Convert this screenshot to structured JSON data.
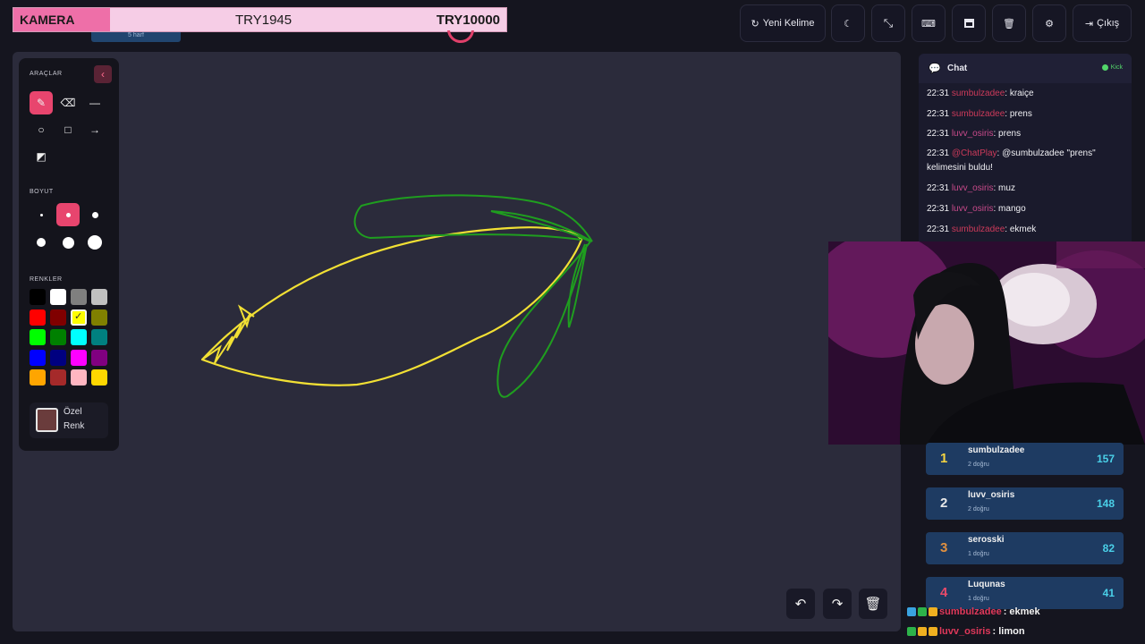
{
  "banner": {
    "left": "KAMERA",
    "mid": "TRY1945",
    "right": "TRY10000"
  },
  "word_hint": "5 harf",
  "toolbar": {
    "new_word": "Yeni Kelime",
    "exit": "Çıkış",
    "icons": [
      "refresh-icon",
      "moon-icon",
      "fullscreen-icon",
      "keyboard-icon",
      "archive-icon",
      "trash-icon",
      "gear-icon",
      "sign-out-icon"
    ]
  },
  "tools": {
    "section_tools": "ARAÇLAR",
    "section_size": "BOYUT",
    "section_colors": "RENKLER",
    "custom_color_line1": "Özel",
    "custom_color_line2": "Renk",
    "colors": [
      "#000000",
      "#ffffff",
      "#7f7f7f",
      "#c0c0c0",
      "#ff0000",
      "#800000",
      "#ffff00",
      "#808000",
      "#00ff00",
      "#008000",
      "#00ffff",
      "#008080",
      "#0000ff",
      "#000080",
      "#ff00ff",
      "#800080",
      "#ffa500",
      "#a52a2a",
      "#ffb6c1",
      "#ffd700"
    ],
    "selected_color": "#ffff00",
    "custom_color": "#6a3c3c"
  },
  "chat": {
    "title": "Chat",
    "platform": "Kick",
    "messages": [
      {
        "time": "22:31",
        "user": "sumbulzadee",
        "text": ": kraiçe"
      },
      {
        "time": "22:31",
        "user": "sumbulzadee",
        "text": ": prens"
      },
      {
        "time": "22:31",
        "user": "luvv_osiris",
        "text": ": prens"
      },
      {
        "time": "22:31",
        "user": "@ChatPlay",
        "text": ": @sumbulzadee \"prens\" kelimesini buldu!"
      },
      {
        "time": "22:31",
        "user": "luvv_osiris",
        "text": ": muz"
      },
      {
        "time": "22:31",
        "user": "luvv_osiris",
        "text": ": mango"
      },
      {
        "time": "22:31",
        "user": "sumbulzadee",
        "text": ": ekmek"
      }
    ]
  },
  "leaderboard": [
    {
      "rank": "1",
      "name": "sumbulzadee",
      "sub": "2 doğru",
      "score": "157",
      "color": "#f5d442"
    },
    {
      "rank": "2",
      "name": "luvv_osiris",
      "sub": "2 doğru",
      "score": "148",
      "color": "#e8e8e8"
    },
    {
      "rank": "3",
      "name": "serosski",
      "sub": "1 doğru",
      "score": "82",
      "color": "#e09040"
    },
    {
      "rank": "4",
      "name": "Luqunas",
      "sub": "1 doğru",
      "score": "41",
      "color": "#e84a6a"
    }
  ],
  "overlay_chat": [
    {
      "user": "sumbulzadee",
      "text": " : ekmek",
      "user_color": "#e0385a"
    },
    {
      "user": "luvv_osiris",
      "text": " : limon",
      "user_color": "#e0385a"
    }
  ]
}
